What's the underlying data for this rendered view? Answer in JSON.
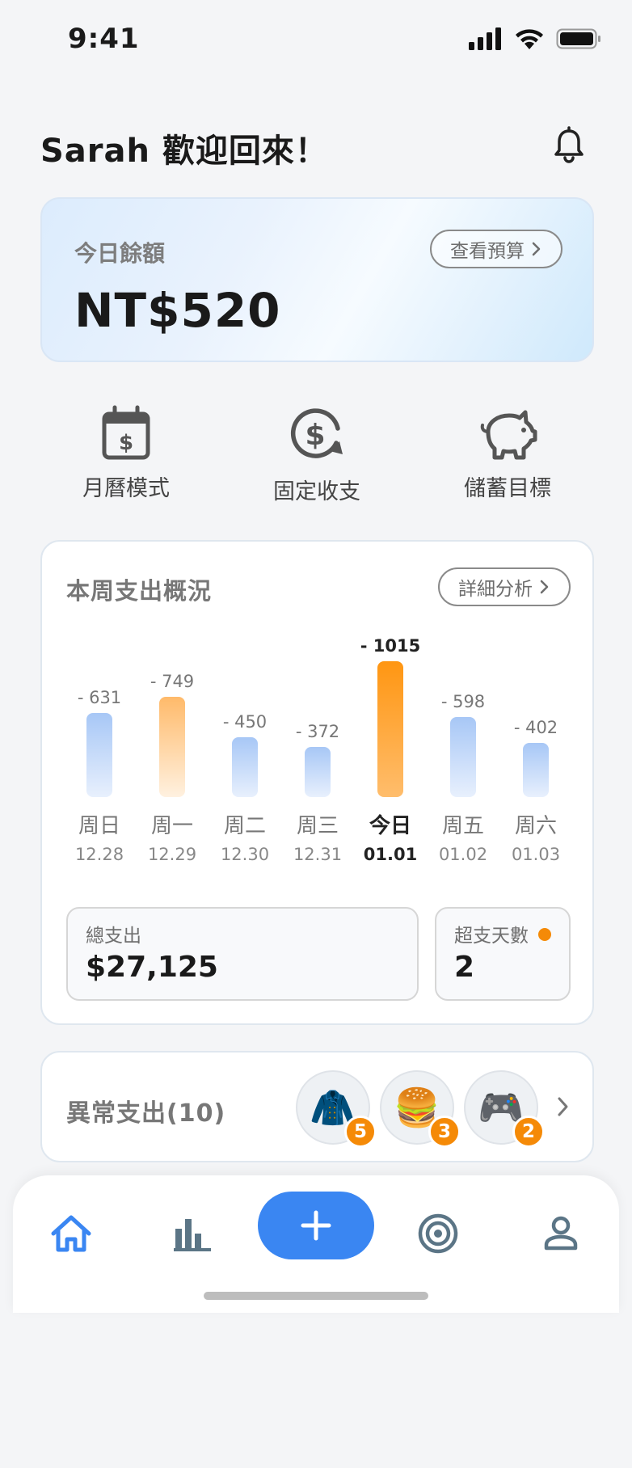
{
  "status_bar": {
    "time": "9:41"
  },
  "header": {
    "greeting": "Sarah 歡迎回來！"
  },
  "balance": {
    "label": "今日餘額",
    "value": "NT$520",
    "budget_button": "查看預算"
  },
  "quick_actions": [
    {
      "label": "月曆模式",
      "icon": "calendar-dollar-icon"
    },
    {
      "label": "固定收支",
      "icon": "recurring-dollar-icon"
    },
    {
      "label": "儲蓄目標",
      "icon": "piggy-bank-icon"
    }
  ],
  "weekly": {
    "title": "本周支出概況",
    "detail_button": "詳細分析",
    "total_label": "總支出",
    "total_value": "$27,125",
    "over_label": "超支天數",
    "over_value": "2"
  },
  "chart_data": {
    "type": "bar",
    "categories": [
      "周日",
      "周一",
      "周二",
      "周三",
      "今日",
      "周五",
      "周六"
    ],
    "dates": [
      "12.28",
      "12.29",
      "12.30",
      "12.31",
      "01.01",
      "01.02",
      "01.03"
    ],
    "values": [
      631,
      749,
      450,
      372,
      1015,
      598,
      402
    ],
    "value_labels": [
      "- 631",
      "-  749",
      "- 450",
      "- 372",
      "- 1015",
      "- 598",
      "- 402"
    ],
    "highlight": [
      false,
      true,
      false,
      false,
      true,
      false,
      false
    ],
    "today_index": 4,
    "colors": {
      "normal": "#a9c9f7",
      "highlight": "#ffb05a",
      "today": "#ff9a1f"
    }
  },
  "abnormal": {
    "title": "異常支出(10)",
    "categories": [
      {
        "emoji": "🧥",
        "icon": "clothing-icon",
        "count": "5"
      },
      {
        "emoji": "🍔",
        "icon": "food-icon",
        "count": "3"
      },
      {
        "emoji": "🎮",
        "icon": "game-icon",
        "count": "2"
      }
    ]
  },
  "nav": {
    "items": [
      "home-icon",
      "chart-icon",
      "add-icon",
      "target-icon",
      "profile-icon"
    ],
    "active": "home-icon",
    "accent": "#3a86f2"
  }
}
